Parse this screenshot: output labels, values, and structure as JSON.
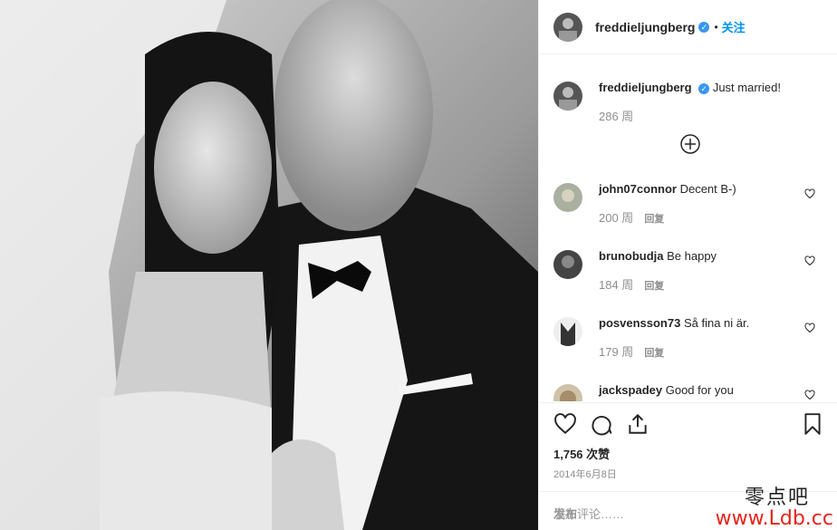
{
  "post": {
    "username": "freddieljungberg",
    "follow_label": "关注",
    "dot": "•",
    "caption_user": "freddieljungberg",
    "caption": "Just married!",
    "caption_time": "286 周",
    "likes": "1,756 次赞",
    "date": "2014年6月8日",
    "add_comment_placeholder": "添加评论……",
    "post_label": "发布"
  },
  "comments": [
    {
      "user": "john07connor",
      "text": "Decent B-)",
      "time": "200 周",
      "reply": "回复"
    },
    {
      "user": "brunobudja",
      "text": "Be happy",
      "time": "184 周",
      "reply": "回复"
    },
    {
      "user": "posvensson73",
      "text": "Så fina ni är.",
      "time": "179 周",
      "reply": "回复"
    },
    {
      "user": "jackspadey",
      "text": "Good for you",
      "time": "",
      "reply": ""
    }
  ],
  "watermark": {
    "line1": "零点吧",
    "line2": "www.Ldb.cc"
  },
  "colors": {
    "link": "#0095f6",
    "verified": "#3897f0",
    "muted": "#8e8e8e"
  }
}
